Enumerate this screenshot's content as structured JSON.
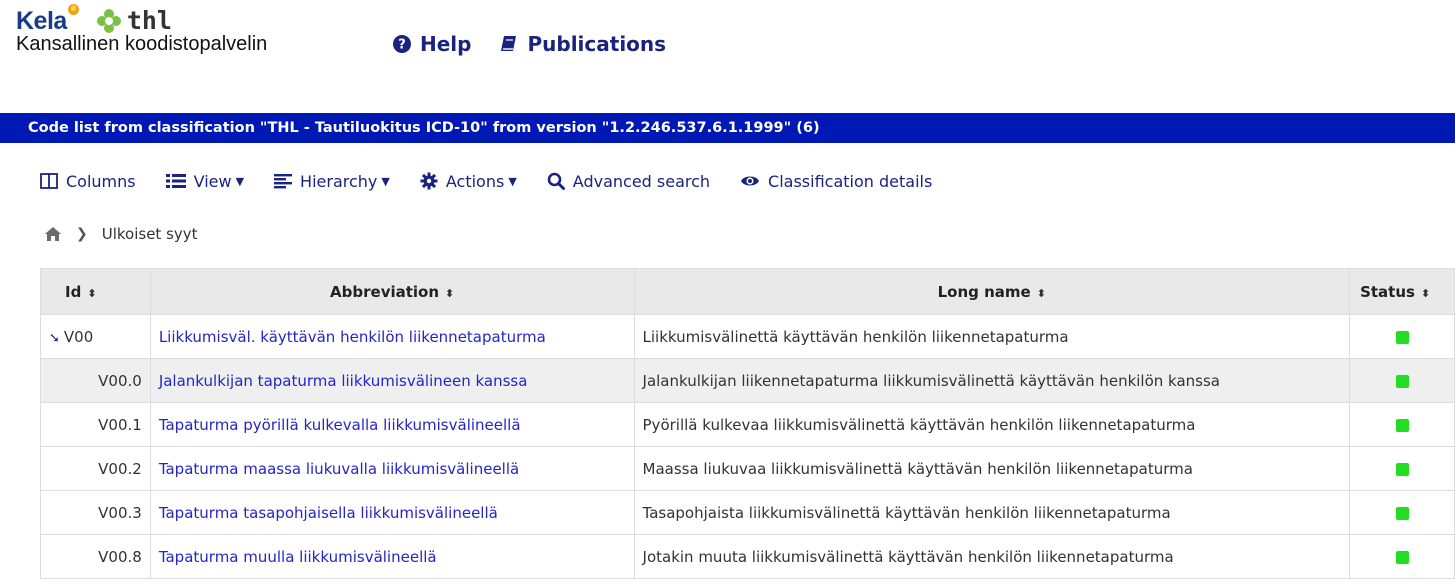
{
  "header": {
    "logo_kela": "Kela",
    "logo_thl": "thl",
    "service_name": "Kansallinen koodistopalvelin",
    "nav": [
      {
        "label": "Help",
        "icon": "question-circle-icon"
      },
      {
        "label": "Publications",
        "icon": "book-icon"
      }
    ]
  },
  "titlebar": {
    "text": "Code list from classification \"THL - Tautiluokitus ICD-10\" from version \"1.2.246.537.6.1.1999\" (6)"
  },
  "toolbar": {
    "columns": "Columns",
    "view": "View",
    "hierarchy": "Hierarchy",
    "actions": "Actions",
    "advanced_search": "Advanced search",
    "classification_details": "Classification details"
  },
  "breadcrumb": {
    "current": "Ulkoiset syyt"
  },
  "table": {
    "headers": {
      "id": "Id",
      "abbreviation": "Abbreviation",
      "long_name": "Long name",
      "status": "Status"
    },
    "rows": [
      {
        "id": "V00",
        "abbreviation": "Liikkumisväl. käyttävän henkilön liikennetapaturma",
        "long_name": "Liikkumisvälinettä käyttävän henkilön liikennetapaturma",
        "status": "active"
      },
      {
        "id": "V00.0",
        "abbreviation": "Jalankulkijan tapaturma liikkumisvälineen kanssa",
        "long_name": "Jalankulkijan liikennetapaturma liikkumisvälinettä käyttävän henkilön kanssa",
        "status": "active"
      },
      {
        "id": "V00.1",
        "abbreviation": "Tapaturma pyörillä kulkevalla liikkumisvälineellä",
        "long_name": "Pyörillä kulkevaa liikkumisvälinettä käyttävän henkilön liikennetapaturma",
        "status": "active"
      },
      {
        "id": "V00.2",
        "abbreviation": "Tapaturma maassa liukuvalla liikkumisvälineellä",
        "long_name": "Maassa liukuvaa liikkumisvälinettä käyttävän henkilön liikennetapaturma",
        "status": "active"
      },
      {
        "id": "V00.3",
        "abbreviation": "Tapaturma tasapohjaisella liikkumisvälineellä",
        "long_name": "Tasapohjaista liikkumisvälinettä käyttävän henkilön liikennetapaturma",
        "status": "active"
      },
      {
        "id": "V00.8",
        "abbreviation": "Tapaturma muulla liikkumisvälineellä",
        "long_name": "Jotakin muuta liikkumisvälinettä käyttävän henkilön liikennetapaturma",
        "status": "active"
      }
    ]
  },
  "colors": {
    "titlebar_bg": "#0019b4",
    "link": "#2525c8",
    "nav": "#1a237e",
    "status_active": "#22dd22"
  }
}
